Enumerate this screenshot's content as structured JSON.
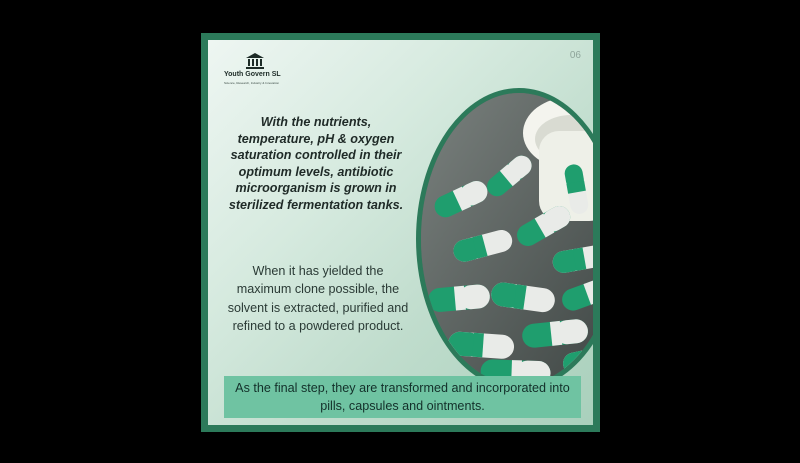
{
  "brand": {
    "name": "Youth Govern SL",
    "tagline": "Science, Research, Industry & Innovation",
    "icon": "pillar-building-icon"
  },
  "page_number": "06",
  "headline": "With the nutrients, temperature, pH & oxygen saturation controlled in their optimum levels, antibiotic microorganism is grown in sterilized fermentation tanks.",
  "body": "When it has yielded the maximum clone possible, the solvent is extracted, purified and refined to a powdered product.",
  "banner": "As the final step, they are transformed and incorporated into pills, capsules and ointments.",
  "colors": {
    "frame": "#2c7a5a",
    "banner": "#6fc3a2",
    "capsule_green": "#1f9e6e",
    "capsule_white": "#e9ebe8"
  }
}
